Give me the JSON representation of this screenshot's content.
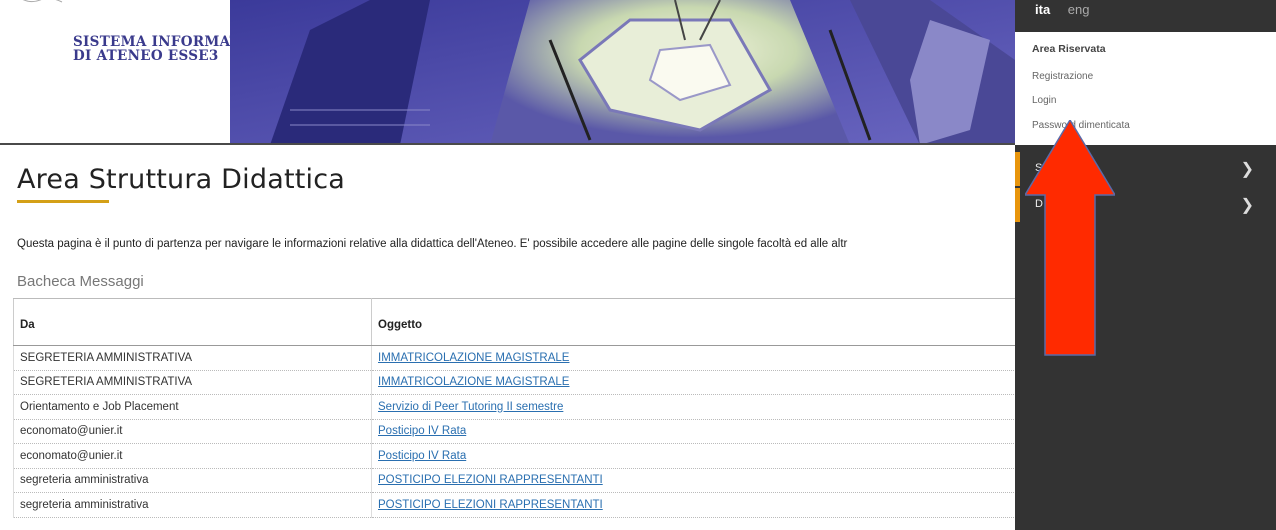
{
  "header": {
    "logo_text_line1": "SISTEMA INFORMATICO",
    "logo_text_line2": "DI ATENEO ESSE3"
  },
  "main": {
    "title": "Area Struttura Didattica",
    "intro": "Questa pagina è il punto di partenza per navigare le informazioni relative alla didattica dell'Ateneo. E' possibile accedere alle pagine delle singole facoltà ed alle altr",
    "bacheca_title": "Bacheca Messaggi",
    "table": {
      "headers": [
        "Da",
        "Oggetto"
      ],
      "rows": [
        {
          "da": "SEGRETERIA AMMINISTRATIVA",
          "oggetto": "IMMATRICOLAZIONE MAGISTRALE"
        },
        {
          "da": "SEGRETERIA AMMINISTRATIVA",
          "oggetto": "IMMATRICOLAZIONE MAGISTRALE"
        },
        {
          "da": "Orientamento e Job Placement",
          "oggetto": "Servizio di Peer Tutoring II semestre"
        },
        {
          "da": "economato@unier.it",
          "oggetto": "Posticipo IV Rata"
        },
        {
          "da": "economato@unier.it",
          "oggetto": "Posticipo IV Rata"
        },
        {
          "da": "segreteria amministrativa",
          "oggetto": "POSTICIPO ELEZIONI RAPPRESENTANTI"
        },
        {
          "da": "segreteria amministrativa",
          "oggetto": "POSTICIPO ELEZIONI RAPPRESENTANTI"
        }
      ]
    }
  },
  "sidebar": {
    "lang_active": "ita",
    "lang_other": "eng",
    "reserved_title": "Area Riservata",
    "links": [
      "Registrazione",
      "Login",
      "Password dimenticata"
    ],
    "menu_items": [
      {
        "label": "S"
      },
      {
        "label": "D"
      }
    ]
  },
  "colors": {
    "accent": "#e8950c",
    "title_underline": "#d4a017",
    "arrow": "#ff2a00",
    "sidebar_bg": "#333333"
  }
}
